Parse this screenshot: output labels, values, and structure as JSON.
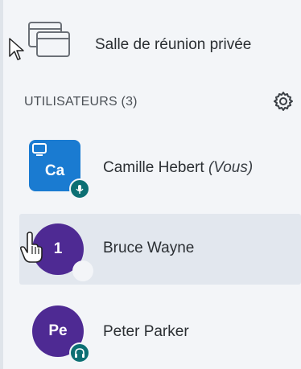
{
  "breakout": {
    "label": "Salle de réunion privée"
  },
  "users_section": {
    "title": "UTILISATEURS (3)"
  },
  "users": [
    {
      "initials": "Ca",
      "name": "Camille Hebert",
      "suffix": "(Vous)",
      "avatar_color": "#1a7bd1",
      "badge": "microphone-muted"
    },
    {
      "initials": "1",
      "name": "Bruce Wayne",
      "avatar_color": "#4e2a93",
      "badge": "none"
    },
    {
      "initials": "Pe",
      "name": "Peter Parker",
      "avatar_color": "#4e2a93",
      "badge": "headphones"
    }
  ],
  "colors": {
    "panel_bg": "#f3f5f8",
    "badge_teal": "#0c6f73",
    "hover_bg": "#e2e7ee"
  }
}
